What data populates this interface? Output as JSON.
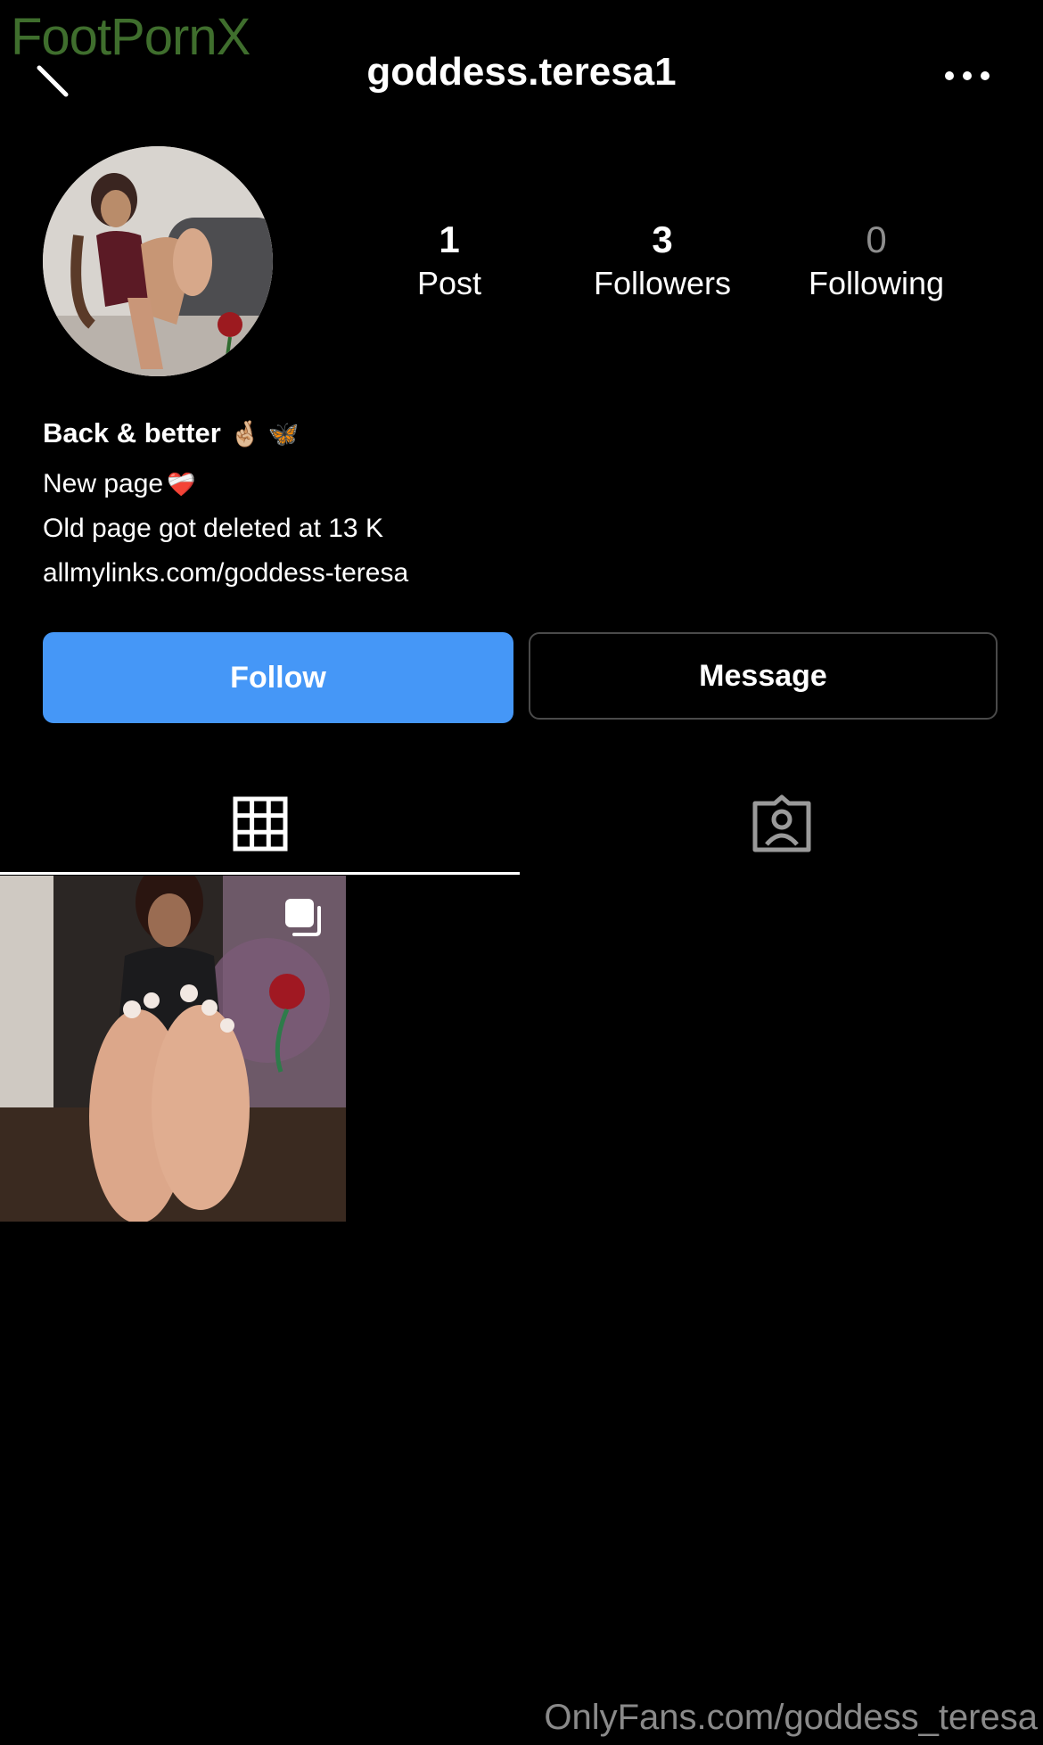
{
  "watermarks": {
    "top": "FootPornX",
    "bottom": "OnlyFans.com/goddess_teresa"
  },
  "header": {
    "username": "goddess.teresa1",
    "back_icon": "back-arrow-icon",
    "more_icon": "more-dots-icon"
  },
  "stats": {
    "posts": {
      "count": "1",
      "label": "Post"
    },
    "followers": {
      "count": "3",
      "label": "Followers"
    },
    "following": {
      "count": "0",
      "label": "Following"
    }
  },
  "bio": {
    "name": "Back & better",
    "name_emojis": "🤞🏼 🦋",
    "line1": "New page",
    "line1_emoji": "❤️‍🩹",
    "line2": "Old page got deleted at 13 K",
    "link": "allmylinks.com/goddess-teresa"
  },
  "actions": {
    "follow_label": "Follow",
    "message_label": "Message"
  },
  "tabs": {
    "grid_icon": "grid-icon",
    "tagged_icon": "tagged-icon"
  },
  "colors": {
    "background": "#000000",
    "follow_button": "#4597f7",
    "watermark_top": "#3f6e2d"
  }
}
